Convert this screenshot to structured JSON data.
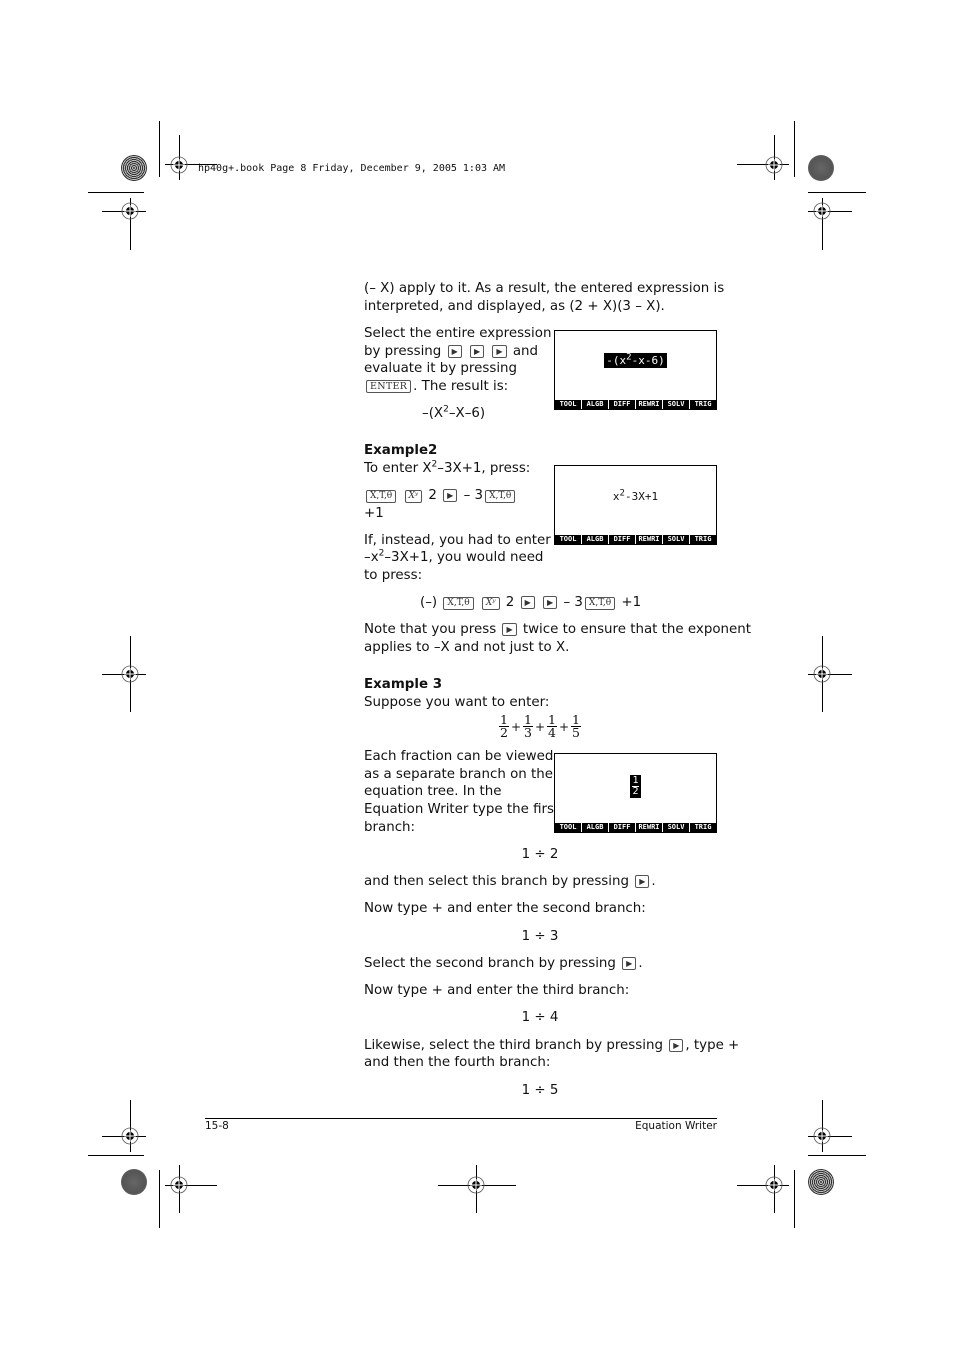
{
  "print_slug": "hp40g+.book  Page 8  Friday, December 9, 2005  1:03 AM",
  "content": {
    "intro_lines": [
      "(– X) apply to it. As a result, the entered expression is",
      "interpreted, and displayed, as (2 + X)(3 – X)."
    ],
    "select_para": {
      "line1": "Select the entire expression",
      "line2_pre": "by pressing",
      "line2_post": "and",
      "line3": "evaluate it by pressing",
      "line4_post": ". The result is:"
    },
    "result_expr": {
      "pre": "–(X",
      "sup": "2",
      "post": "–X–6)"
    },
    "example2": {
      "heading": "Example2",
      "intro": {
        "pre": "To enter X",
        "sup": "2",
        "post": "–3X+1, press:"
      },
      "keys_line": {
        "t1": "2",
        "t2": "– 3",
        "t3": "+1"
      },
      "instead": {
        "line1": "If, instead, you had to enter",
        "line2_pre": "–x",
        "line2_sup": "2",
        "line2_post": "–3X+1, you would need",
        "line3": "to press:"
      },
      "keys_line2": {
        "t0": "(–)",
        "t1": "2",
        "t2": "– 3",
        "t3": "+1"
      },
      "note": {
        "pre": "Note that you press",
        "post": "twice to ensure that the exponent",
        "line2": "applies to –X and not just to X."
      }
    },
    "example3": {
      "heading": "Example 3",
      "intro": "Suppose you want to enter:",
      "fractions": [
        {
          "n": "1",
          "d": "2"
        },
        {
          "n": "1",
          "d": "3"
        },
        {
          "n": "1",
          "d": "4"
        },
        {
          "n": "1",
          "d": "5"
        }
      ],
      "plus": "+",
      "para_lines": [
        "Each fraction can be viewed",
        "as a separate branch on the",
        "equation tree. In the",
        "Equation Writer type the first",
        "branch:"
      ],
      "step1": "1 ÷ 2",
      "select1": {
        "pre": "and then select this branch by pressing",
        "post": "."
      },
      "type2": "Now type + and enter the second branch:",
      "step2": "1 ÷ 3",
      "select2": {
        "pre": "Select the second branch by pressing",
        "post": "."
      },
      "type3": "Now type + and enter the third branch:",
      "step3": "1 ÷ 4",
      "select3": {
        "pre": "Likewise, select the third branch by pressing",
        "post": ", type +",
        "line2": "and then the fourth branch:"
      },
      "step4": "1 ÷ 5"
    }
  },
  "keys": {
    "right_arrow": "▶",
    "enter": "ENTER",
    "xtheta": "X,T,θ",
    "xy": "Xʸ"
  },
  "screens": {
    "menu": [
      "TOOL",
      "ALGB",
      "DIFF",
      "REWRI",
      "SOLV",
      "TRIG"
    ],
    "screen1": {
      "pre": "-(x",
      "sup": "2",
      "post": "-x-6)"
    },
    "screen2": {
      "pre": "x",
      "sup": "2",
      "post": "-3X+1"
    },
    "screen3": {
      "n": "1",
      "d": "2"
    }
  },
  "footer": {
    "page_number": "15-8",
    "chapter": "Equation Writer"
  }
}
